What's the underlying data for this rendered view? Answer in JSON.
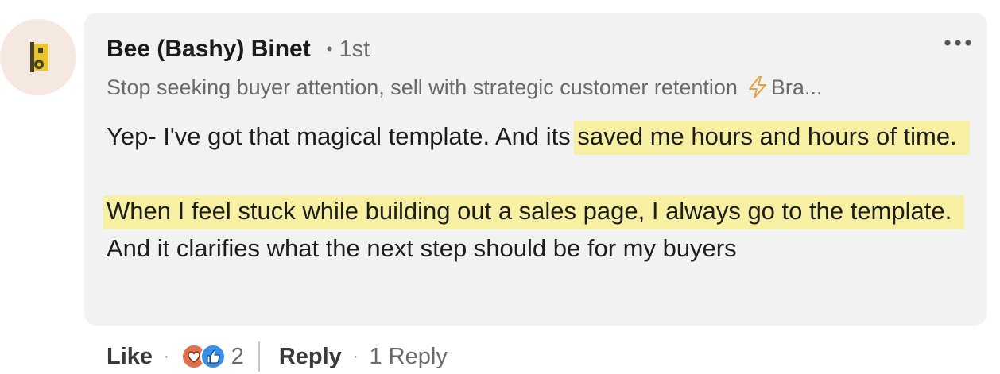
{
  "author": {
    "name": "Bee (Bashy) Binet",
    "degree_separator": "•",
    "degree": "1st",
    "headline": "Stop seeking buyer attention, sell with strategic customer retention",
    "headline_trailing": "Bra...",
    "avatar_icon": "brand-logo-icon"
  },
  "menu": {
    "more_icon": "more-horizontal-icon"
  },
  "comment": {
    "paragraph1": {
      "plain": "Yep- I've got that magical template. And its ",
      "highlighted": "saved me hours and hours of time."
    },
    "paragraph2": {
      "highlighted": "When I feel stuck while building out a sales page, I always go to the template.",
      "plain": " And it clarifies what the next step should be for my buyers"
    },
    "highlight_color": "#f7f0a3"
  },
  "actions": {
    "like_label": "Like",
    "dot": "·",
    "reaction_count": "2",
    "reaction_icons": [
      "love-reaction-icon",
      "thumbs-up-reaction-icon"
    ],
    "reply_label": "Reply",
    "replies_label": "1 Reply"
  },
  "colors": {
    "bubble": "#f2f2f2",
    "avatar_bg": "#f4e8e0",
    "love": "#df704d",
    "like": "#378fe9",
    "bolt": "#e7a33e",
    "logo_dark": "#4a4019",
    "logo_yellow": "#e9c52b"
  }
}
